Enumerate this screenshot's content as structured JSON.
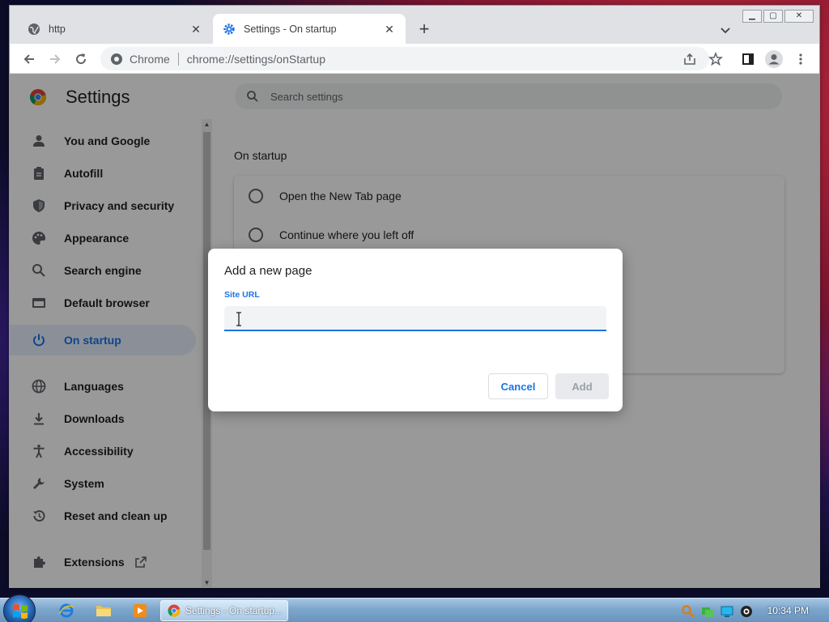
{
  "tabs": [
    {
      "label": "http"
    },
    {
      "label": "Settings - On startup"
    }
  ],
  "toolbar": {
    "site_chip": "Chrome",
    "url": "chrome://settings/onStartup"
  },
  "settings": {
    "title": "Settings",
    "search_placeholder": "Search settings",
    "nav": [
      {
        "label": "You and Google",
        "icon": "person-icon"
      },
      {
        "label": "Autofill",
        "icon": "clipboard-icon"
      },
      {
        "label": "Privacy and security",
        "icon": "shield-icon"
      },
      {
        "label": "Appearance",
        "icon": "palette-icon"
      },
      {
        "label": "Search engine",
        "icon": "search-icon"
      },
      {
        "label": "Default browser",
        "icon": "browser-icon"
      },
      {
        "label": "On startup",
        "icon": "power-icon",
        "active": true
      },
      {
        "label": "Languages",
        "icon": "globe-icon"
      },
      {
        "label": "Downloads",
        "icon": "download-icon"
      },
      {
        "label": "Accessibility",
        "icon": "accessibility-icon"
      },
      {
        "label": "System",
        "icon": "wrench-icon"
      },
      {
        "label": "Reset and clean up",
        "icon": "history-icon"
      },
      {
        "label": "Extensions",
        "icon": "puzzle-icon"
      }
    ],
    "section_title": "On startup",
    "options": [
      {
        "label": "Open the New Tab page"
      },
      {
        "label": "Continue where you left off"
      }
    ]
  },
  "dialog": {
    "title": "Add a new page",
    "field_label": "Site URL",
    "field_value": "",
    "cancel_label": "Cancel",
    "add_label": "Add"
  },
  "taskbar": {
    "active_window": "Settings - On startup...",
    "clock": "10:34 PM"
  },
  "colors": {
    "accent": "#1a73e8",
    "active_nav_bg": "#e8f0fe"
  }
}
